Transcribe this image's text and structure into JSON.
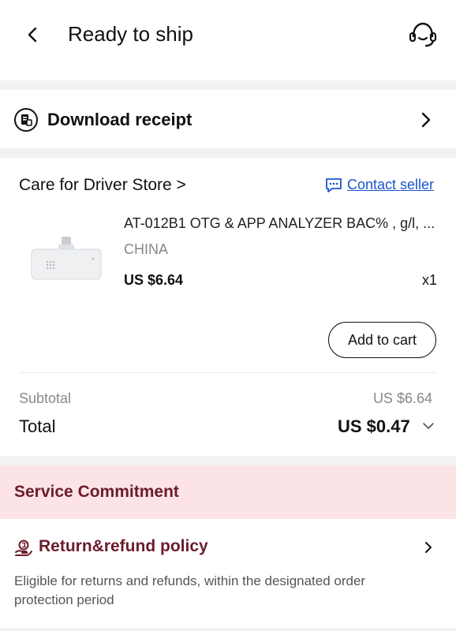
{
  "header": {
    "title": "Ready to ship",
    "back_icon": "chevron-left-icon",
    "support_icon": "headset-icon"
  },
  "receipt": {
    "label": "Download receipt",
    "icon": "receipt-icon"
  },
  "order": {
    "store_name": "Care for Driver Store >",
    "contact_label": "Contact seller",
    "product": {
      "name": "AT-012B1 OTG & APP ANALYZER BAC% , g/l, ...",
      "origin": "CHINA",
      "price": "US $6.64",
      "quantity": "x1"
    },
    "add_to_cart_label": "Add to cart",
    "subtotal_label": "Subtotal",
    "subtotal_value": "US $6.64",
    "total_label": "Total",
    "total_value": "US $0.47"
  },
  "service": {
    "title": "Service Commitment"
  },
  "policy": {
    "title": "Return&refund policy",
    "description": "Eligible for returns and refunds, within the designated order protection period"
  },
  "colors": {
    "link_blue": "#1a56c9",
    "service_bg": "#fce4e6",
    "service_text": "#6b1d2b"
  }
}
